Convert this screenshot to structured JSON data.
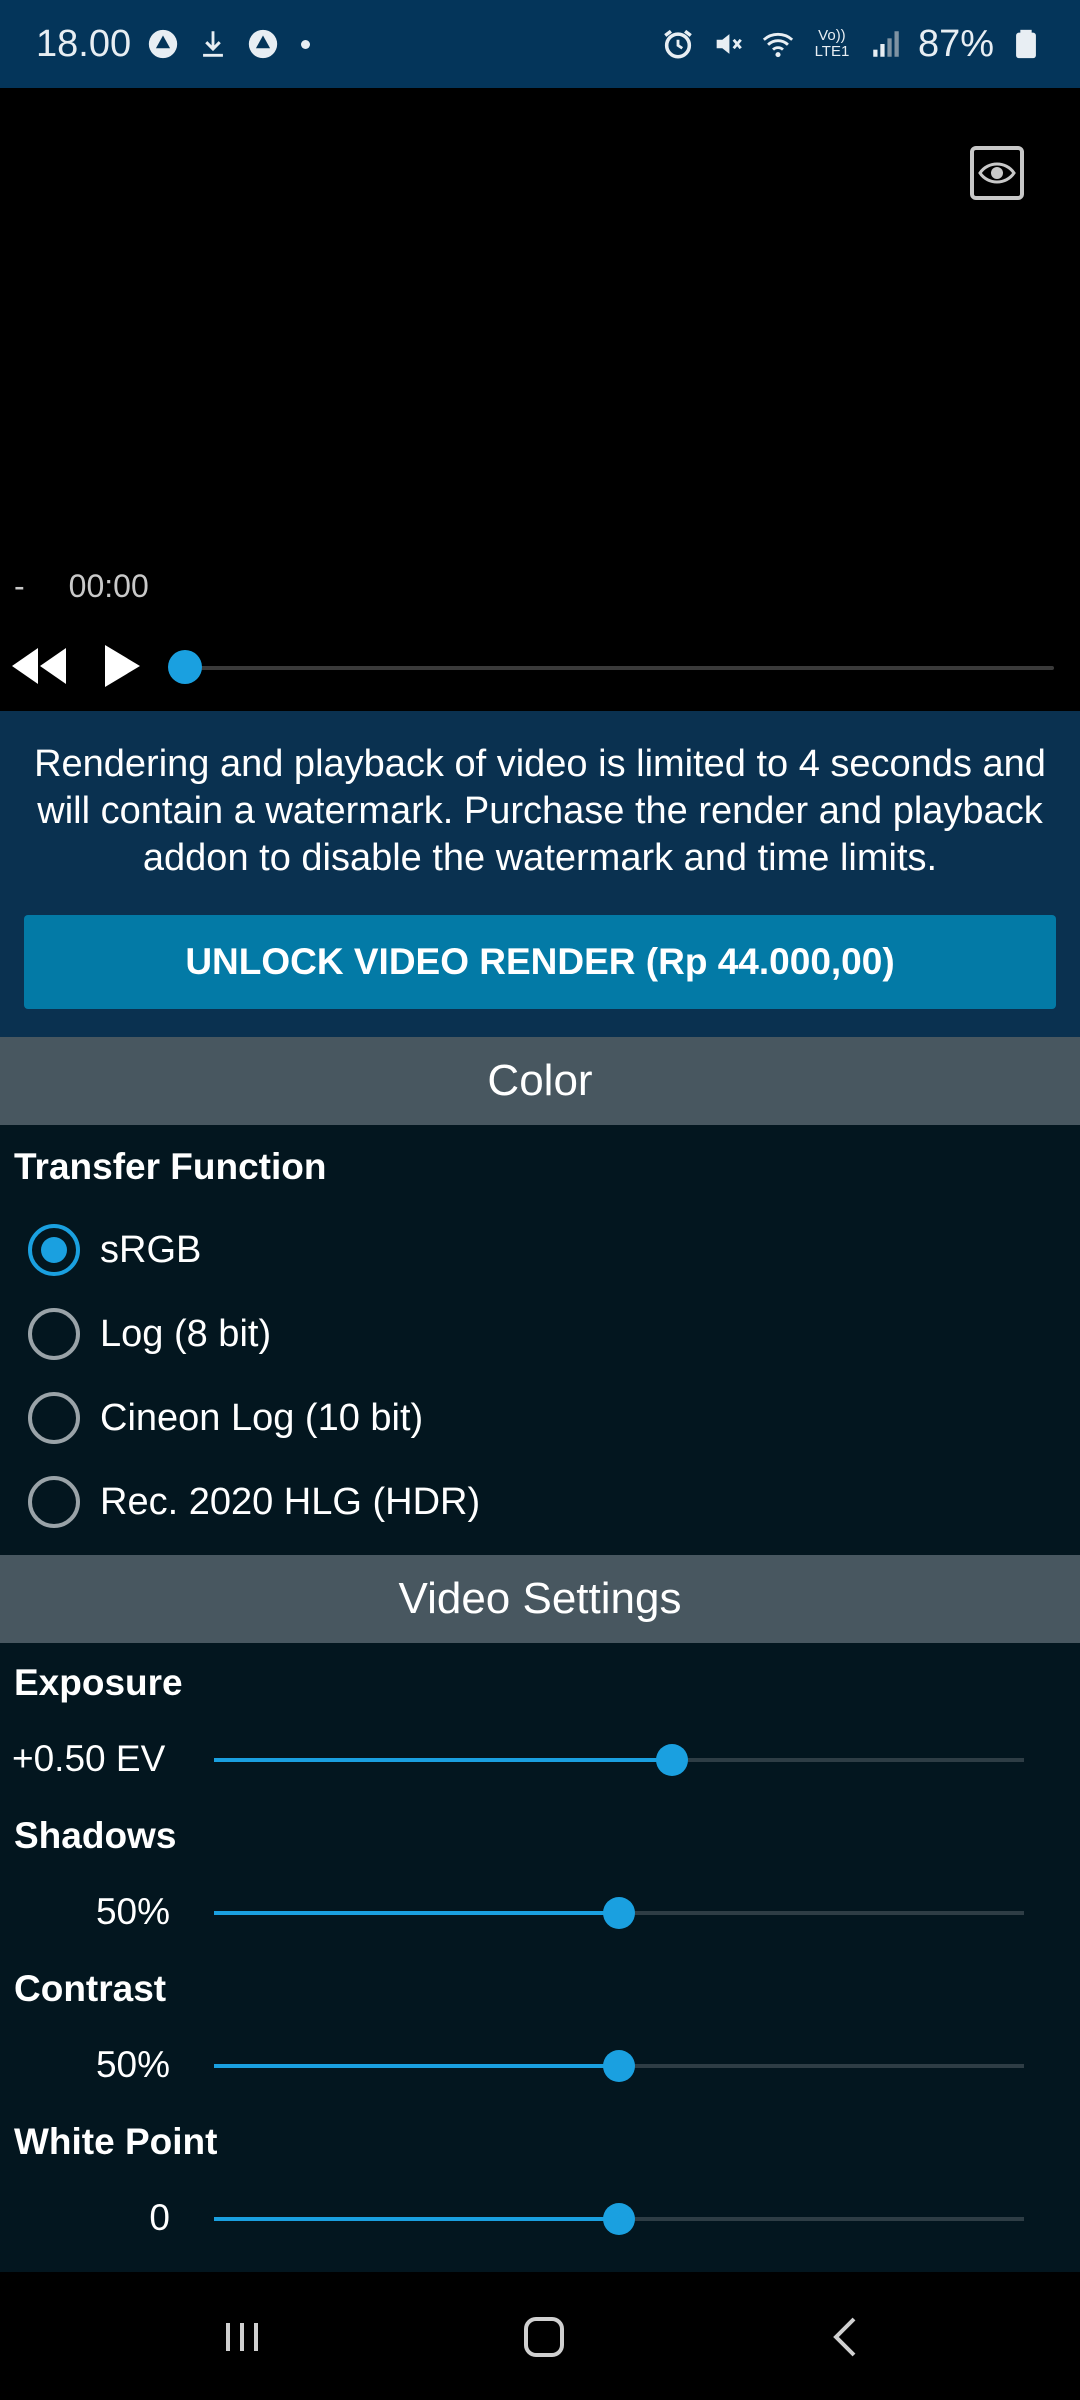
{
  "status_bar": {
    "time": "18.00",
    "battery": "87%",
    "icons_left": [
      "app-icon",
      "download-icon",
      "app-icon",
      "dot"
    ],
    "icons_right": [
      "alarm-icon",
      "mute-icon",
      "wifi-icon",
      "volte-icon",
      "signal-icon",
      "battery-icon"
    ],
    "volte": "Vo)) LTE1"
  },
  "player": {
    "position_label": "-",
    "time": "00:00",
    "progress": 0,
    "accent_color": "#1aa0e0"
  },
  "promo": {
    "message": "Rendering and playback of video is limited to 4 seconds and will contain a watermark. Purchase the render and playback addon to disable the watermark and time limits.",
    "unlock_label": "UNLOCK VIDEO RENDER (Rp 44.000,00)"
  },
  "color_section": {
    "title": "Color",
    "transfer_label": "Transfer Function",
    "options": [
      {
        "label": "sRGB",
        "selected": true
      },
      {
        "label": "Log (8 bit)",
        "selected": false
      },
      {
        "label": "Cineon Log (10 bit)",
        "selected": false
      },
      {
        "label": "Rec. 2020 HLG (HDR)",
        "selected": false
      }
    ]
  },
  "video_settings": {
    "title": "Video Settings",
    "sliders": [
      {
        "label": "Exposure",
        "value_text": "+0.50 EV",
        "fraction": 0.565
      },
      {
        "label": "Shadows",
        "value_text": "50%",
        "fraction": 0.5
      },
      {
        "label": "Contrast",
        "value_text": "50%",
        "fraction": 0.5
      },
      {
        "label": "White Point",
        "value_text": "0",
        "fraction": 0.5
      }
    ]
  },
  "nav_bar": {
    "icons": [
      "recents-icon",
      "home-icon",
      "back-icon"
    ]
  }
}
